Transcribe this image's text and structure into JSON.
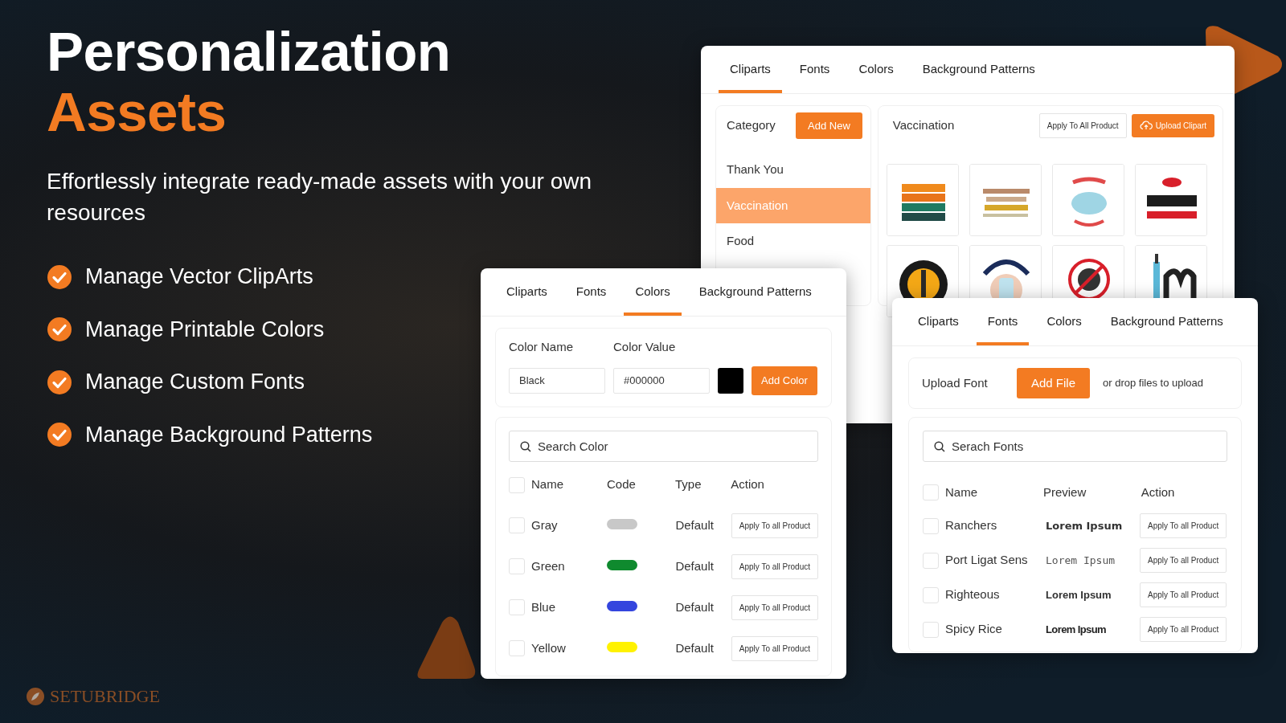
{
  "headline": {
    "line_1": "Personalization",
    "line_2": "Assets"
  },
  "subtitle": "Effortlessly integrate ready-made assets with your own resources",
  "features": [
    "Manage Vector ClipArts",
    "Manage Printable Colors",
    "Manage Custom Fonts",
    "Manage Background Patterns"
  ],
  "brand": "SETUBRIDGE",
  "clipart_window": {
    "tabs": [
      {
        "label": "Cliparts",
        "selected": true
      },
      {
        "label": "Fonts",
        "selected": false
      },
      {
        "label": "Colors",
        "selected": false
      },
      {
        "label": "Background Patterns",
        "selected": false
      }
    ],
    "category_label": "Category",
    "add_button": "Add New",
    "categories": [
      {
        "label": "Thank You",
        "selected": false
      },
      {
        "label": "Vaccination",
        "selected": true
      },
      {
        "label": "Food",
        "selected": false
      }
    ],
    "heading": "Vaccination",
    "apply_button": "Apply To All Product",
    "upload_button": "Upload Clipart"
  },
  "colors_window": {
    "tabs": [
      {
        "label": "Cliparts",
        "selected": false
      },
      {
        "label": "Fonts",
        "selected": false
      },
      {
        "label": "Colors",
        "selected": true
      },
      {
        "label": "Background Patterns",
        "selected": false
      }
    ],
    "color_name_label": "Color Name",
    "color_value_label": "Color Value",
    "name_field": {
      "value": "Black"
    },
    "value_field": {
      "value": "#000000"
    },
    "add_button": "Add Color",
    "search": {
      "placeholder": "Search Color"
    },
    "header_checked": false,
    "columns": [
      "Name",
      "Code",
      "Type",
      "Action"
    ],
    "rows": [
      {
        "name": "Gray",
        "color": "#c8c8c8",
        "type": "Default",
        "action": "Apply To all Product",
        "checked": false
      },
      {
        "name": "Green",
        "color": "#0f8a2e",
        "type": "Default",
        "action": "Apply To all Product",
        "checked": false
      },
      {
        "name": "Blue",
        "color": "#3445de",
        "type": "Default",
        "action": "Apply To all Product",
        "checked": false
      },
      {
        "name": "Yellow",
        "color": "#fff200",
        "type": "Default",
        "action": "Apply To all Product",
        "checked": false
      }
    ]
  },
  "fonts_window": {
    "tabs": [
      {
        "label": "Cliparts",
        "selected": false
      },
      {
        "label": "Fonts",
        "selected": true
      },
      {
        "label": "Colors",
        "selected": false
      },
      {
        "label": "Background Patterns",
        "selected": false
      }
    ],
    "upload_label": "Upload Font",
    "add_button": "Add File",
    "drop_hint": "or drop files to upload",
    "search": {
      "placeholder": "Serach Fonts"
    },
    "header_checked": false,
    "columns": [
      "Name",
      "Preview",
      "Action"
    ],
    "rows": [
      {
        "name": "Ranchers",
        "preview": "Lorem Ipsum",
        "kind": "heavy",
        "action": "Apply To all Product",
        "checked": false
      },
      {
        "name": "Port Ligat Sens",
        "preview": "Lorem Ipsum",
        "kind": "light",
        "action": "Apply To all Product",
        "checked": false
      },
      {
        "name": "Righteous",
        "preview": "Lorem Ipsum",
        "kind": "bold",
        "action": "Apply To all Product",
        "checked": false
      },
      {
        "name": "Spicy Rice",
        "preview": "Lorem Ipsum",
        "kind": "condensed",
        "action": "Apply To all Product",
        "checked": false
      }
    ]
  }
}
